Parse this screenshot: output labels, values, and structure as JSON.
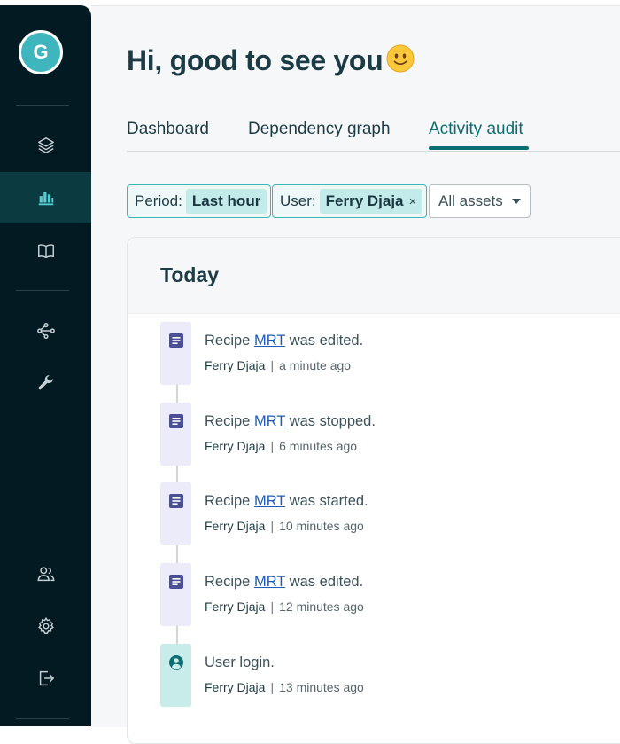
{
  "sidebar": {
    "avatar_initial": "G",
    "nav": [
      {
        "icon": "layers-icon",
        "active": false
      },
      {
        "icon": "bar-chart-icon",
        "active": true
      },
      {
        "icon": "book-icon",
        "active": false
      },
      {
        "icon": "network-icon",
        "active": false
      },
      {
        "icon": "wrench-icon",
        "active": false
      },
      {
        "icon": "users-icon",
        "active": false
      },
      {
        "icon": "gear-icon",
        "active": false
      },
      {
        "icon": "logout-icon",
        "active": false
      }
    ]
  },
  "header": {
    "greeting": "Hi, good to see you",
    "emoji": "smiley-face-icon"
  },
  "tabs": [
    {
      "label": "Dashboard",
      "active": false
    },
    {
      "label": "Dependency graph",
      "active": false
    },
    {
      "label": "Activity audit",
      "active": true
    }
  ],
  "filters": {
    "period": {
      "label": "Period:",
      "value": "Last hour"
    },
    "user": {
      "label": "User:",
      "value": "Ferry Djaja",
      "close": "×"
    },
    "assets": {
      "label": "All assets"
    }
  },
  "activity": {
    "section_title": "Today",
    "events": [
      {
        "type": "recipe",
        "prefix": "Recipe",
        "link": "MRT",
        "suffix": "was edited.",
        "user": "Ferry Djaja",
        "sep": "|",
        "time": "a minute ago"
      },
      {
        "type": "recipe",
        "prefix": "Recipe",
        "link": "MRT",
        "suffix": "was stopped.",
        "user": "Ferry Djaja",
        "sep": "|",
        "time": "6 minutes ago"
      },
      {
        "type": "recipe",
        "prefix": "Recipe",
        "link": "MRT",
        "suffix": "was started.",
        "user": "Ferry Djaja",
        "sep": "|",
        "time": "10 minutes ago"
      },
      {
        "type": "recipe",
        "prefix": "Recipe",
        "link": "MRT",
        "suffix": "was edited.",
        "user": "Ferry Djaja",
        "sep": "|",
        "time": "12 minutes ago"
      },
      {
        "type": "login",
        "text": "User login.",
        "user": "Ferry Djaja",
        "sep": "|",
        "time": "13 minutes ago"
      }
    ]
  },
  "colors": {
    "sidebar_bg": "#041a22",
    "accent": "#0c6d72",
    "link": "#1e5bb8",
    "chip_border": "#3ab8b8",
    "recipe_icon": "#4a4f96",
    "login_icon": "#0c6d72"
  }
}
